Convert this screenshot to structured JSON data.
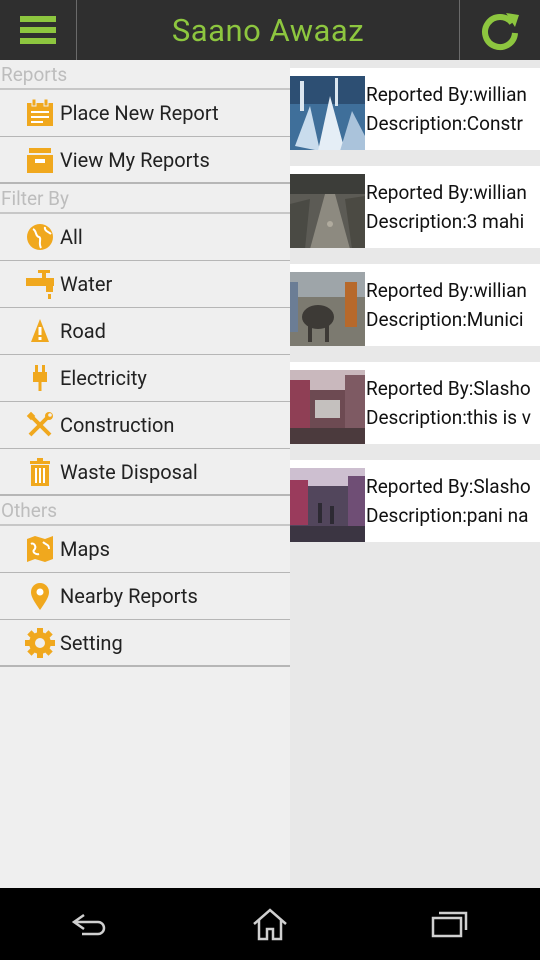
{
  "app": {
    "title": "Saano Awaaz"
  },
  "drawer": {
    "sections": {
      "reports": "Reports",
      "filter": "Filter By",
      "others": "Others"
    },
    "reports_items": [
      {
        "label": "Place New Report",
        "icon": "clipboard-icon"
      },
      {
        "label": "View My Reports",
        "icon": "inbox-icon"
      }
    ],
    "filter_items": [
      {
        "label": "All",
        "icon": "globe-icon"
      },
      {
        "label": "Water",
        "icon": "faucet-icon"
      },
      {
        "label": "Road",
        "icon": "road-cone-icon"
      },
      {
        "label": "Electricity",
        "icon": "plug-icon"
      },
      {
        "label": "Construction",
        "icon": "tools-icon"
      },
      {
        "label": "Waste Disposal",
        "icon": "trash-icon"
      }
    ],
    "others_items": [
      {
        "label": "Maps",
        "icon": "map-icon"
      },
      {
        "label": "Nearby Reports",
        "icon": "location-pin-icon"
      },
      {
        "label": "Setting",
        "icon": "gear-icon"
      }
    ]
  },
  "reports": [
    {
      "reported_by": "Reported By:willian",
      "description": "Description:Constr"
    },
    {
      "reported_by": "Reported By:willian",
      "description": "Description:3 mahi"
    },
    {
      "reported_by": "Reported By:willian",
      "description": "Description:Munici"
    },
    {
      "reported_by": "Reported By:Slasho",
      "description": "Description:this is v"
    },
    {
      "reported_by": "Reported By:Slasho",
      "description": "Description:pani na"
    }
  ],
  "colors": {
    "accent": "#8dc63f",
    "icon": "#f0a81e",
    "topbar": "#2f2f2f"
  }
}
